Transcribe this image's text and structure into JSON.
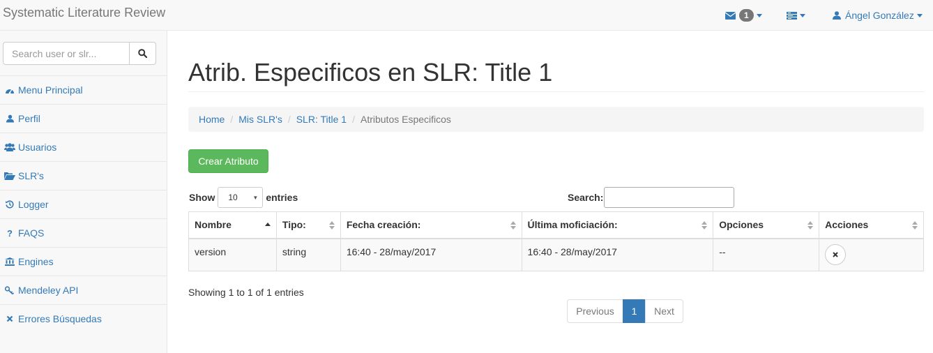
{
  "navbar": {
    "brand": "Systematic Literature Review",
    "messages_count": "1",
    "user_name": "Ángel González"
  },
  "sidebar": {
    "search_placeholder": "Search user or slr...",
    "items": [
      {
        "label": "Menu Principal",
        "icon": "dashboard-icon"
      },
      {
        "label": "Perfil",
        "icon": "user-icon"
      },
      {
        "label": "Usuarios",
        "icon": "users-icon"
      },
      {
        "label": "SLR's",
        "icon": "folder-open-icon"
      },
      {
        "label": "Logger",
        "icon": "history-icon"
      },
      {
        "label": "FAQS",
        "icon": "question-icon"
      },
      {
        "label": "Engines",
        "icon": "bank-icon"
      },
      {
        "label": "Mendeley API",
        "icon": "key-icon"
      },
      {
        "label": "Errores Búsquedas",
        "icon": "times-icon"
      }
    ]
  },
  "main": {
    "title": "Atrib. Especificos en SLR: Title 1",
    "breadcrumb": [
      "Home",
      "Mis SLR's",
      "SLR: Title 1",
      "Atributos Especificos"
    ],
    "create_button": "Crear Atributo",
    "length": {
      "show": "Show",
      "value": "10",
      "entries": "entries"
    },
    "search_label": "Search:",
    "columns": [
      "Nombre",
      "Tipo:",
      "Fecha creación:",
      "Última moficiación:",
      "Opciones",
      "Acciones"
    ],
    "rows": [
      {
        "nombre": "version",
        "tipo": "string",
        "fecha": "16:40 - 28/may/2017",
        "ultima": "16:40 - 28/may/2017",
        "opciones": "--"
      }
    ],
    "info": "Showing 1 to 1 of 1 entries",
    "pagination": {
      "previous": "Previous",
      "current": "1",
      "next": "Next"
    }
  },
  "colors": {
    "link": "#337ab7",
    "success": "#5cb85c",
    "active_page": "#337ab7"
  }
}
